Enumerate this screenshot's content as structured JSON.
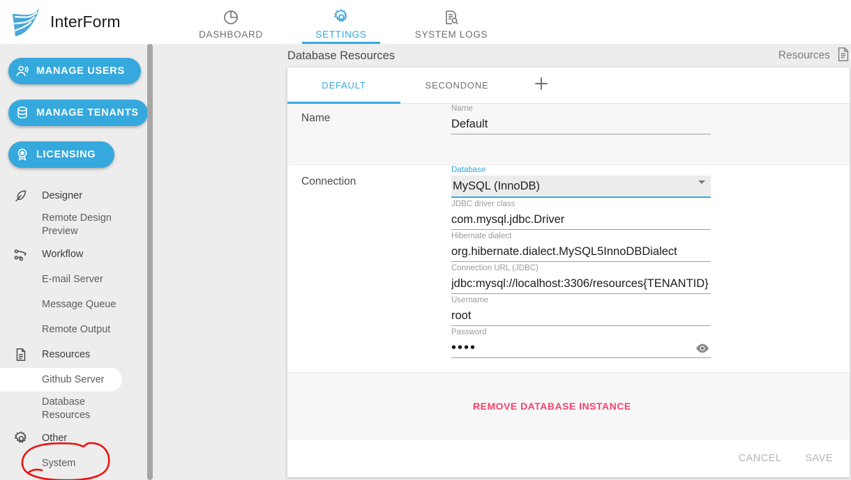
{
  "app": {
    "brand_name": "InterForm",
    "logo_icon": "interform-fan-logo"
  },
  "topnav": {
    "tabs": [
      {
        "label": "DASHBOARD",
        "icon": "pie-chart-icon",
        "active": false
      },
      {
        "label": "SETTINGS",
        "icon": "gear-icon",
        "active": true
      },
      {
        "label": "SYSTEM LOGS",
        "icon": "document-search-icon",
        "active": false
      }
    ]
  },
  "sidebar": {
    "buttons": [
      {
        "label": "MANAGE USERS",
        "icon": "users-icon"
      },
      {
        "label": "MANAGE TENANTS",
        "icon": "database-icon"
      },
      {
        "label": "LICENSING",
        "icon": "badge-icon"
      }
    ],
    "items": [
      {
        "label": "Designer",
        "icon": "feather-icon",
        "type": "group"
      },
      {
        "label": "Remote Design Preview",
        "type": "child"
      },
      {
        "label": "Workflow",
        "icon": "workflow-icon",
        "type": "group"
      },
      {
        "label": "E-mail Server",
        "type": "child"
      },
      {
        "label": "Message Queue",
        "type": "child"
      },
      {
        "label": "Remote Output",
        "type": "child"
      },
      {
        "label": "Resources",
        "icon": "page-icon",
        "type": "group"
      },
      {
        "label": "Github Server",
        "type": "child",
        "highlighted": true
      },
      {
        "label": "Database Resources",
        "type": "child",
        "annotated": true
      },
      {
        "label": "Other",
        "icon": "gear-icon",
        "type": "group"
      },
      {
        "label": "System",
        "type": "child"
      }
    ]
  },
  "page": {
    "title": "Database Resources",
    "header_right_label": "Resources",
    "header_right_icon": "document-icon"
  },
  "card": {
    "tabs": [
      {
        "label": "DEFAULT",
        "active": true
      },
      {
        "label": "SECONDONE",
        "active": false
      }
    ],
    "add_tab_icon": "plus-icon",
    "sections": [
      {
        "label": "Name"
      },
      {
        "label": "Connection"
      }
    ],
    "name_field": {
      "label": "Name",
      "value": "Default"
    },
    "connection_fields": [
      {
        "label": "Database",
        "value": "MySQL (InnoDB)",
        "type": "select",
        "focused": true,
        "icon": "chevron-down-icon"
      },
      {
        "label": "JDBC driver class",
        "value": "com.mysql.jdbc.Driver",
        "type": "text"
      },
      {
        "label": "Hibernate dialect",
        "value": "org.hibernate.dialect.MySQL5InnoDBDialect",
        "type": "text"
      },
      {
        "label": "Connection URL (JDBC)",
        "value": "jdbc:mysql://localhost:3306/resources{TENANTID}",
        "type": "text"
      },
      {
        "label": "Username",
        "value": "root",
        "type": "text"
      },
      {
        "label": "Password",
        "value": "••••",
        "type": "password",
        "icon": "eye-icon"
      }
    ],
    "remove_button": "REMOVE DATABASE INSTANCE",
    "footer": {
      "cancel_label": "CANCEL",
      "save_label": "SAVE"
    }
  },
  "annotation": {
    "shape": "red-ellipse-circle",
    "color": "#ee1111",
    "target": "Database Resources"
  },
  "colors": {
    "accent": "#35a8dd",
    "danger": "#f4436c",
    "background": "#ededed",
    "card": "#ffffff",
    "section_alt": "#f7f7f7"
  }
}
